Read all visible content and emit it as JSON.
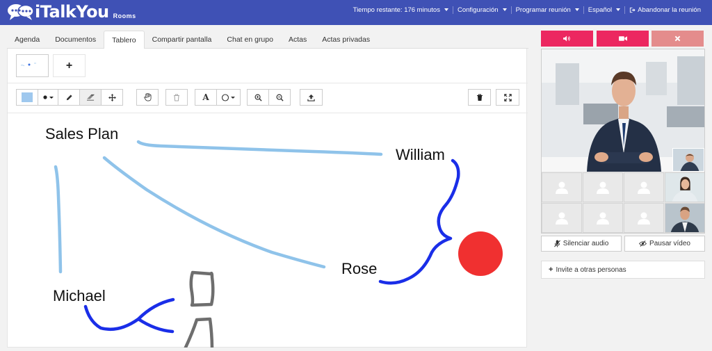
{
  "app": {
    "logo_text": "iTalkYou",
    "logo_sub": "Rooms"
  },
  "topnav": {
    "time_left": "Tiempo restante: 176 minutos",
    "config": "Configuración",
    "schedule": "Programar reunión",
    "language": "Español",
    "leave": "Abandonar la reunión"
  },
  "tabs": [
    "Agenda",
    "Documentos",
    "Tablero",
    "Compartir pantalla",
    "Chat en grupo",
    "Actas",
    "Actas privadas"
  ],
  "active_tab": "Tablero",
  "slides": {
    "add_label": "+"
  },
  "toolbar": {
    "color": "#9fc8ee",
    "tools": [
      "color-picker",
      "dot-size",
      "pencil",
      "eraser",
      "move",
      "hand",
      "trash",
      "text",
      "shape",
      "zoom-in",
      "zoom-out",
      "upload",
      "clear",
      "fullscreen"
    ],
    "text_label": "A"
  },
  "whiteboard": {
    "labels": [
      "Sales Plan",
      "William",
      "Rose",
      "Michael"
    ],
    "colors": {
      "light": "#8fc3ea",
      "blue": "#1a2ee8",
      "grey": "#6e6e6e",
      "red": "#f03030"
    }
  },
  "controls": {
    "colors": {
      "audio": "#ec2760",
      "video": "#ec2760",
      "close": "#e48c8c"
    }
  },
  "side": {
    "mute": "Silenciar audio",
    "pause": "Pausar vídeo",
    "invite": "Invite a otras personas"
  }
}
